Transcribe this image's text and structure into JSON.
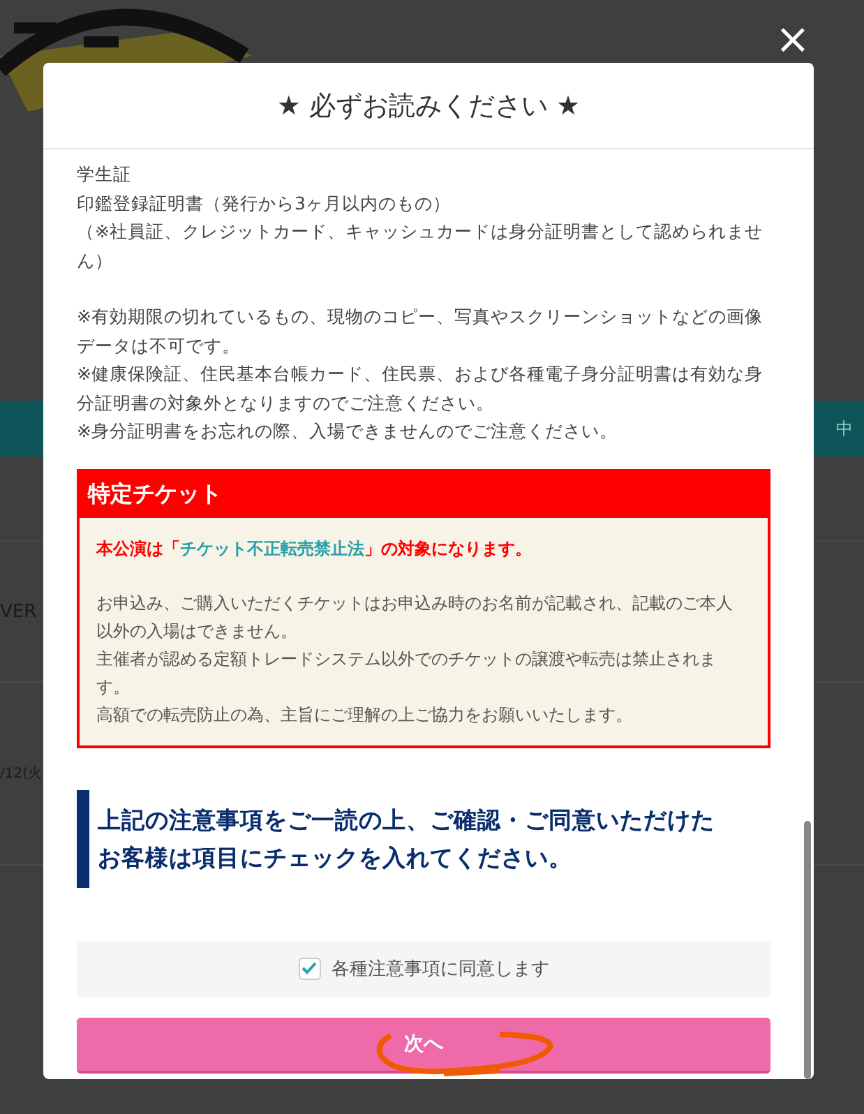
{
  "background_page": {
    "left_texts": [
      "VER",
      "/12(火"
    ],
    "right_text": "中"
  },
  "close_button": {
    "label": "×"
  },
  "modal": {
    "title": "★ 必ずお読みください ★",
    "id_lines": [
      "学生証",
      "印鑑登録証明書（発行から3ヶ月以内のもの）",
      "（※社員証、クレジットカード、キャッシュカードは身分証明書として認められません）"
    ],
    "notes": [
      "※有効期限の切れているもの、現物のコピー、写真やスクリーンショットなどの画像データは不可です。",
      "※健康保険証、住民基本台帳カード、住民票、および各種電子身分証明書は有効な身分証明書の対象外となりますのでご注意ください。",
      "※身分証明書をお忘れの際、入場できませんのでご注意ください。"
    ],
    "special_ticket": {
      "heading": "特定チケット",
      "lead_before": "本公演は「",
      "lead_link": "チケット不正転売禁止法",
      "lead_after": "」の対象になります。",
      "paragraphs": [
        "お申込み、ご購入いただくチケットはお申込み時のお名前が記載され、記載のご本人以外の入場はできません。",
        "主催者が認める定額トレードシステム以外でのチケットの譲渡や転売は禁止されます。",
        "高額での転売防止の為、主旨にご理解の上ご協力をお願いいたします。"
      ]
    },
    "confirm_heading": "上記の注意事項をご一読の上、ご確認・ご同意いただけたお客様は項目にチェックを入れてください。",
    "agree_checkbox": {
      "label": "各種注意事項に同意します",
      "checked": true
    },
    "next_button": {
      "label": "次へ"
    }
  }
}
